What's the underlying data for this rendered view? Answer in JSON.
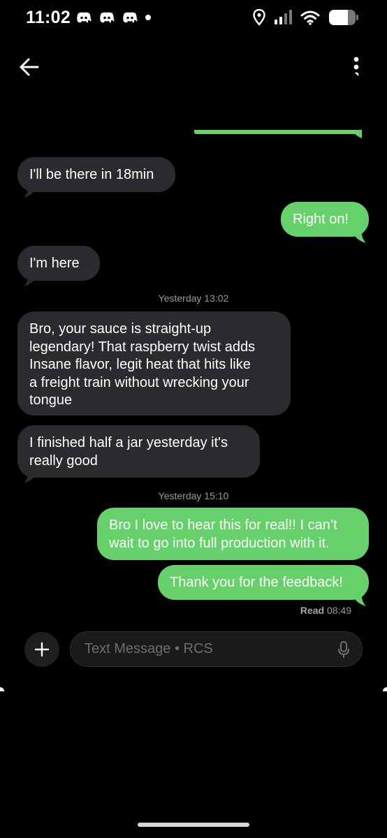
{
  "status_bar": {
    "time": "11:02",
    "left_icons": [
      "discord-icon",
      "discord-icon",
      "discord-icon",
      "dot-icon"
    ],
    "right_icons": [
      "location-icon",
      "signal-icon",
      "wifi-icon",
      "battery-icon"
    ]
  },
  "header": {
    "back_icon": "arrow-left-icon",
    "menu_icon": "more-vert-icon"
  },
  "colors": {
    "incoming_bubble": "#2b2b2f",
    "outgoing_bubble": "#66d16a",
    "background": "#000000",
    "meta_text": "#9a9a9e"
  },
  "messages": [
    {
      "direction": "incoming",
      "text": "I'll be there in 18min"
    },
    {
      "direction": "outgoing",
      "text": "Right on!"
    },
    {
      "direction": "incoming",
      "text": "I'm here"
    },
    {
      "type": "timestamp",
      "text": "Yesterday 13:02"
    },
    {
      "direction": "incoming",
      "lines": [
        "Bro, your sauce is straight-up",
        "legendary! That raspberry twist adds",
        "Insane flavor, legit heat that hits like",
        "a freight train without wrecking your",
        "tongue"
      ]
    },
    {
      "direction": "incoming",
      "lines": [
        "I finished half a jar yesterday it's",
        "really good"
      ]
    },
    {
      "type": "timestamp",
      "text": "Yesterday 15:10"
    },
    {
      "direction": "outgoing",
      "lines": [
        "Bro I love to hear this for real!! I can’t",
        "wait to go into full production with it."
      ]
    },
    {
      "direction": "outgoing",
      "text": "Thank you for the feedback!"
    }
  ],
  "read_receipt": {
    "label": "Read",
    "time": "08:49"
  },
  "composer": {
    "placeholder": "Text Message • RCS",
    "plus_icon": "plus-icon",
    "mic_icon": "mic-icon"
  }
}
